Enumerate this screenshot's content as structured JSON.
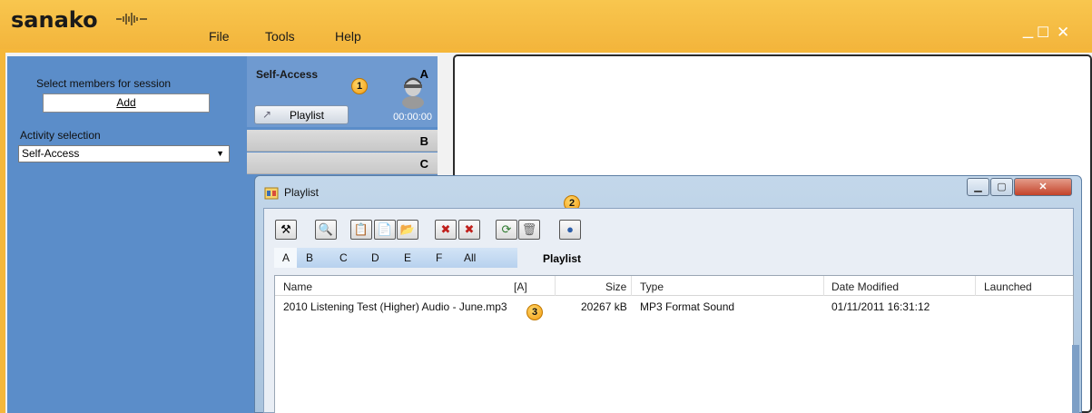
{
  "app": {
    "logo_text": "sanako",
    "menu": [
      "File",
      "Tools",
      "Help"
    ],
    "window_controls": [
      "_",
      "☐",
      "✕"
    ]
  },
  "left_panel": {
    "members_label": "Select members for session",
    "add_button": "Add",
    "activity_label": "Activity selection",
    "activity_value": "Self-Access"
  },
  "student_tile": {
    "name": "Self-Access",
    "letter": "A",
    "playlist_button": "Playlist",
    "time": "00:00:00",
    "rows": [
      "B",
      "C"
    ]
  },
  "badges": [
    "1",
    "2",
    "3"
  ],
  "playlist_dialog": {
    "title": "Playlist",
    "tabs": [
      "A",
      "B",
      "C",
      "D",
      "E",
      "F",
      "All"
    ],
    "active_tab": "A",
    "heading": "Playlist",
    "columns": {
      "name": "Name",
      "a": "[A]",
      "size": "Size",
      "type": "Type",
      "date": "Date Modified",
      "launched": "Launched"
    },
    "rows": [
      {
        "name": "2010 Listening Test (Higher) Audio - June.mp3",
        "size": "20267 kB",
        "type": "MP3 Format Sound",
        "date": "01/11/2011 16:31:12",
        "launched": ""
      }
    ]
  },
  "colors": {
    "titlebar": "#f5b73a",
    "panel_blue": "#5b8dc9",
    "badge": "#f39c12"
  }
}
